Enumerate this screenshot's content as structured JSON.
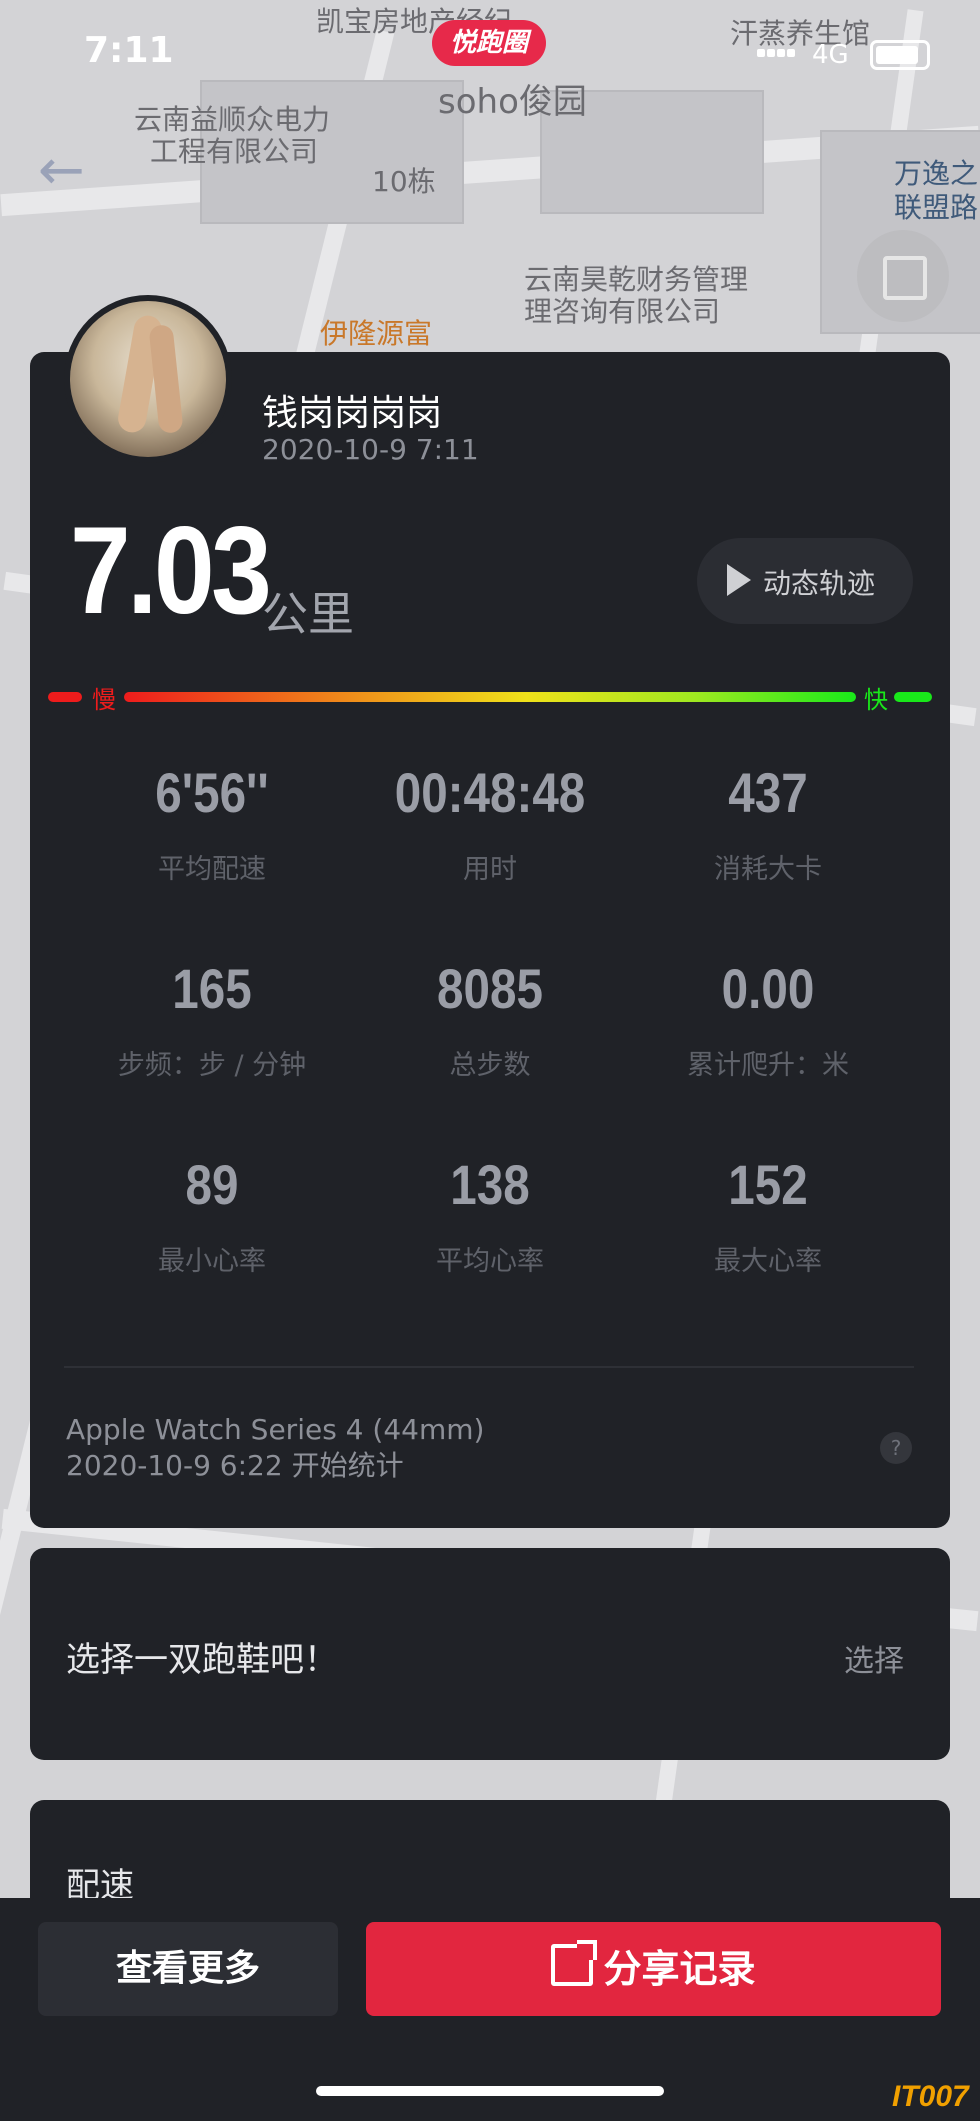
{
  "status_bar": {
    "time": "7:11",
    "network": "4G"
  },
  "app_logo": "悦跑圈",
  "map_labels": [
    "凯宝房地产经纪",
    "云南益顺众电力",
    "工程有限公司",
    "soho俊园",
    "10栋",
    "云南昊乾财务管理",
    "理咨询有限公司",
    "伊隆源富",
    "汗蒸养生馆",
    "万逸之",
    "联盟路"
  ],
  "user": {
    "name": "钱岗岗岗岗",
    "date": "2020-10-9 7:11"
  },
  "distance": {
    "value": "7.03",
    "unit": "公里"
  },
  "track_button": "动态轨迹",
  "pace_bar": {
    "slow": "慢",
    "fast": "快"
  },
  "stats": [
    {
      "value": "6'56''",
      "label": "平均配速"
    },
    {
      "value": "00:48:48",
      "label": "用时"
    },
    {
      "value": "437",
      "label": "消耗大卡"
    },
    {
      "value": "165",
      "label": "步频：步 / 分钟"
    },
    {
      "value": "8085",
      "label": "总步数"
    },
    {
      "value": "0.00",
      "label": "累计爬升：米"
    },
    {
      "value": "89",
      "label": "最小心率"
    },
    {
      "value": "138",
      "label": "平均心率"
    },
    {
      "value": "152",
      "label": "最大心率"
    }
  ],
  "device": {
    "name": "Apple Watch Series 4 (44mm)",
    "start": "2020-10-9 6:22 开始统计"
  },
  "help": "?",
  "shoes": {
    "prompt": "选择一双跑鞋吧！",
    "action": "选择"
  },
  "pace_section": {
    "title": "配速"
  },
  "buttons": {
    "more": "查看更多",
    "share": "分享记录"
  },
  "watermark": "IT007"
}
